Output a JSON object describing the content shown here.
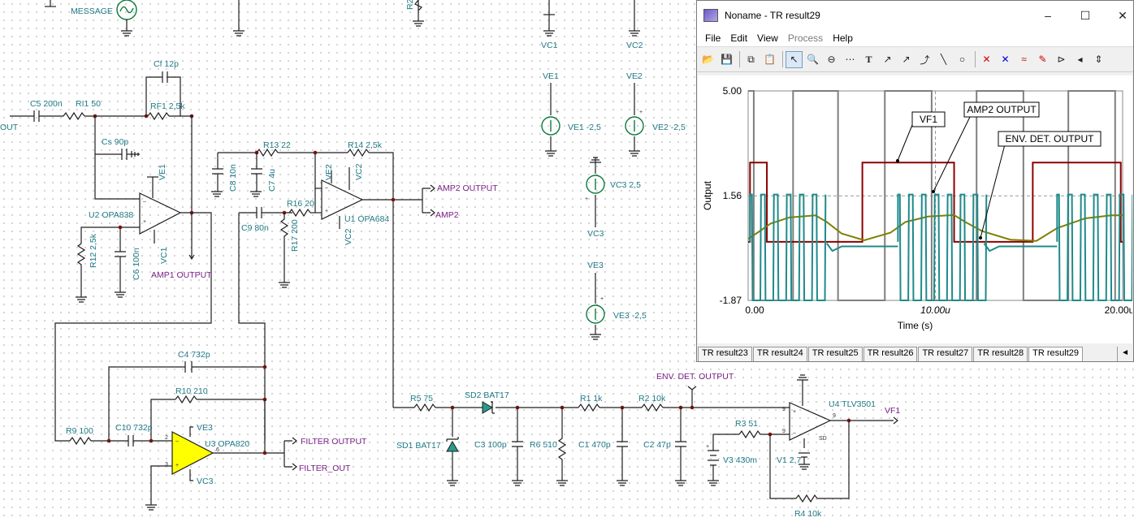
{
  "schematic": {
    "labels": {
      "message": "MESSAGE",
      "out": "OUT",
      "c5": "C5 200n",
      "ri1": "RI1 50",
      "cf": "Cf 12p",
      "rf1": "RF1 2,5k",
      "cs": "Cs 90p",
      "ve1_pin": "VE1",
      "vc1_pin": "VC1",
      "u2": "U2 OPA838",
      "r12": "R12 2,5k",
      "c6": "C6 100n",
      "amp1_output": "AMP1 OUTPUT",
      "r13": "R13 22",
      "r14": "R14 2,5k",
      "c8": "C8 10n",
      "c7": "C7 4u",
      "ve2_pin": "VE2",
      "vc2_pin": "VC2",
      "r16": "R16 20",
      "r17": "R17 200",
      "c9": "C9 80n",
      "u1": "U1 OPA684",
      "amp2_output": "AMP2 OUTPUT",
      "amp2": "AMP2",
      "c4": "C4 732p",
      "r10": "R10 210",
      "r9": "R9 100",
      "c10": "C10 732p",
      "ve3_pin": "VE3",
      "u3": "U3 OPA820",
      "vc3_pin": "VC3",
      "filter_output": "FILTER OUTPUT",
      "filter_out": "FILTER_OUT",
      "r2_top": "R2",
      "vc1": "VC1",
      "vc2": "VC2",
      "ve1": "VE1",
      "ve2": "VE2",
      "ve1_src": "VE1 -2,5",
      "ve2_src": "VE2 -2,5",
      "vc3_src": "VC3 2,5",
      "vc3": "VC3",
      "ve3": "VE3",
      "ve3_src": "VE3 -2,5",
      "r5": "R5 75",
      "sd2": "SD2 BAT17",
      "sd1": "SD1 BAT17",
      "c3": "C3 100p",
      "r6": "R6 510",
      "r1": "R1 1k",
      "c1": "C1 470p",
      "r2": "R2 10k",
      "c2": "C2 47p",
      "env_det_output": "ENV. DET. OUTPUT",
      "u4": "U4 TLV3501",
      "vf1": "VF1",
      "r3": "R3 51",
      "v3": "V3 430m",
      "v1": "V1 2,7",
      "r4": "R4 10k",
      "sd": "SD",
      "pin_2": "2",
      "pin_3": "3",
      "pin_6": "6",
      "pin_9": "9"
    }
  },
  "window": {
    "title": "Noname - TR result29",
    "minimize_icon": "–",
    "maximize_icon": "☐",
    "close_icon": "✕",
    "menu": [
      "File",
      "Edit",
      "View",
      "Process",
      "Help"
    ],
    "toolbar_icons": [
      "open-icon",
      "save-icon",
      "copy-icon",
      "paste-icon",
      "pointer-icon",
      "zoom-in-icon",
      "zoom-100-icon",
      "grid-icon",
      "text-icon",
      "label-icon",
      "label2-icon",
      "arrow-curve-icon",
      "line-icon",
      "circle-icon",
      "cursor-a-icon",
      "cursor-b-icon",
      "wave-icon",
      "marker-icon",
      "flag-icon"
    ],
    "tabs": [
      "TR result23",
      "TR result24",
      "TR result25",
      "TR result26",
      "TR result27",
      "TR result28",
      "TR result29"
    ],
    "active_tab": "TR result29",
    "tab_scroll": "◄"
  },
  "chart_data": {
    "type": "line",
    "ylabel": "Output",
    "xlabel": "Time (s)",
    "y_ticks": [
      "5.00",
      "1.56",
      "-1.87"
    ],
    "x_ticks": [
      "0.00",
      "10.00u",
      "20.00u"
    ],
    "ylim": [
      -1.87,
      5.0
    ],
    "xlim": [
      0,
      20
    ],
    "grid": true,
    "annotations": [
      "VF1",
      "AMP2 OUTPUT",
      "ENV. DET. OUTPUT"
    ],
    "series": [
      {
        "name": "MESSAGE",
        "color": "#7f7f7f",
        "x": [
          0,
          0.3,
          0.3,
          2.4,
          2.4,
          4.8,
          4.8,
          7.3,
          7.3,
          9.8,
          9.8,
          12.2,
          12.2,
          14.7,
          14.7,
          17.1,
          17.1,
          19.6,
          19.6,
          20
        ],
        "y": [
          5,
          5,
          -1.87,
          -1.87,
          5,
          5,
          -1.87,
          -1.87,
          5,
          5,
          -1.87,
          -1.87,
          5,
          5,
          -1.87,
          -1.87,
          5,
          5,
          -1.87,
          -1.87
        ]
      },
      {
        "name": "VF1",
        "color": "#8b0000",
        "x": [
          0,
          0.1,
          0.1,
          1.0,
          1.0,
          6.1,
          6.1,
          11.0,
          11.0,
          15.2,
          15.2,
          19.9,
          19.9,
          20
        ],
        "y": [
          0.05,
          0.05,
          2.65,
          2.65,
          0.05,
          0.05,
          2.65,
          2.65,
          0.05,
          0.05,
          2.65,
          2.65,
          0.05,
          0.05
        ]
      },
      {
        "name": "ENV. DET. OUTPUT",
        "color": "#808000",
        "x": [
          0,
          0.5,
          1.2,
          2.2,
          3.6,
          4.2,
          5.0,
          6.2,
          7.6,
          8.4,
          9.6,
          11.0,
          11.6,
          12.5,
          14.0,
          15.4,
          16.5,
          18.0,
          19.4,
          20.0
        ],
        "y": [
          0.15,
          0.35,
          0.65,
          0.85,
          0.92,
          0.7,
          0.32,
          0.1,
          0.35,
          0.7,
          0.88,
          0.93,
          0.7,
          0.4,
          0.12,
          0.08,
          0.5,
          0.82,
          0.92,
          0.92
        ]
      },
      {
        "name": "AMP2 OUTPUT",
        "color": "#1f8a8a",
        "bursts": [
          [
            0.1,
            4.2
          ],
          [
            8.0,
            12.6
          ],
          [
            16.5,
            20
          ]
        ],
        "burst_high": 1.6,
        "burst_low": -1.87,
        "freq_mhz": 1.45
      }
    ]
  }
}
